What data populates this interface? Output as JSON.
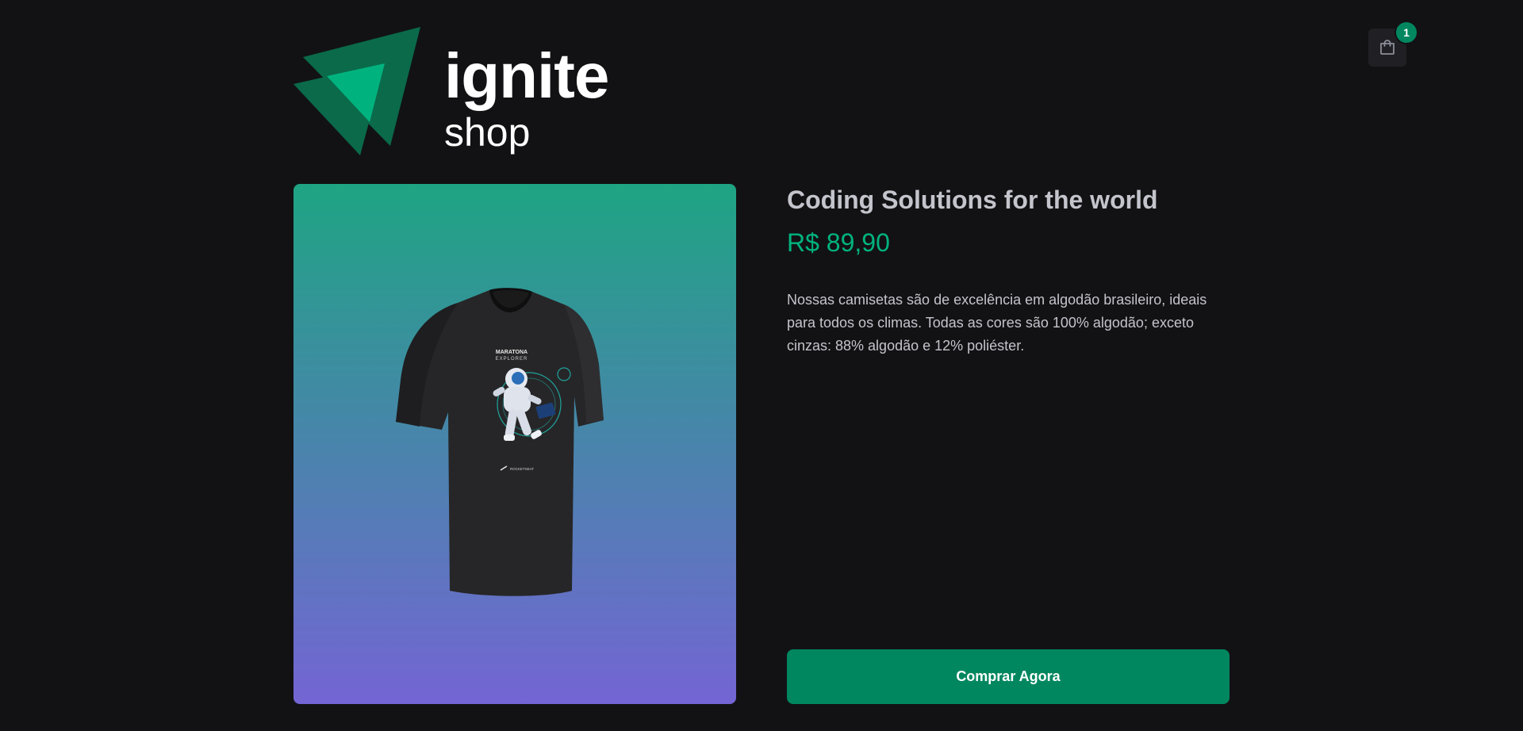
{
  "header": {
    "logo": {
      "word_primary": "ignite",
      "word_secondary": "shop",
      "icon": "triangle-logo-icon"
    },
    "cart": {
      "icon": "handbag-icon",
      "count": "1"
    }
  },
  "product": {
    "title": "Coding Solutions for the world",
    "price": "R$ 89,90",
    "description": "Nossas camisetas são de excelência em algodão brasileiro, ideais para todos os climas. Todas as cores são 100% algodão; exceto cinzas: 88% algodão e 12% poliéster.",
    "buy_label": "Comprar Agora",
    "shirt_print_title": "MARATONA",
    "shirt_print_subtitle": "EXPLORER",
    "shirt_print_brand": "ROCKETSEAT"
  },
  "colors": {
    "background": "#121214",
    "brand_green": "#00875f",
    "price_green": "#00b37e",
    "text": "#c4c4cc",
    "gradient_top": "#1ea483",
    "gradient_bottom": "#7465d4"
  }
}
